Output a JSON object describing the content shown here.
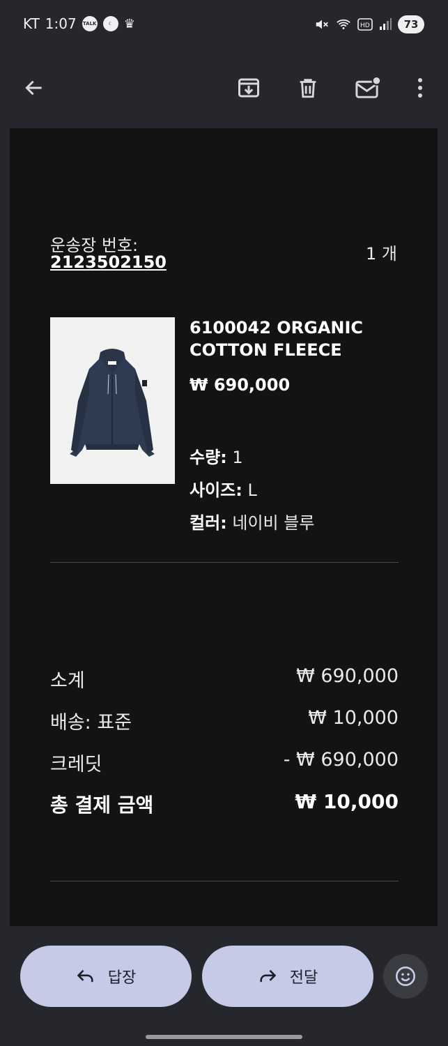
{
  "status_bar": {
    "carrier": "KT",
    "time": "1:07",
    "talk_icon_label": "TALK",
    "battery": "73"
  },
  "toolbar": {
    "back": "back-arrow-icon",
    "archive": "archive-icon",
    "delete": "trash-icon",
    "mark_unread": "mail-unread-icon",
    "more": "more-vert-icon"
  },
  "order": {
    "tracking_label": "운송장 번호:",
    "tracking_number": "2123502150",
    "item_count": "1 개",
    "product": {
      "name": "6100042 ORGANIC COTTON FLEECE",
      "price": "₩ 690,000",
      "qty_label": "수량:",
      "qty_value": " 1",
      "size_label": "사이즈:",
      "size_value": " L",
      "color_label": "컬러:",
      "color_value": " 네이비 블루"
    },
    "summary": [
      {
        "label": "소계",
        "value": "₩ 690,000"
      },
      {
        "label": "배송: 표준",
        "value": "₩ 10,000"
      },
      {
        "label": "크레딧",
        "value": "- ₩ 690,000"
      },
      {
        "label": "총 결제 금액",
        "value": "₩ 10,000"
      }
    ]
  },
  "actions": {
    "reply": "답장",
    "forward": "전달",
    "emoji": "emoji-icon"
  },
  "colors": {
    "background": "#25272c",
    "email_bg": "#131314",
    "pill": "#c5cae6"
  }
}
